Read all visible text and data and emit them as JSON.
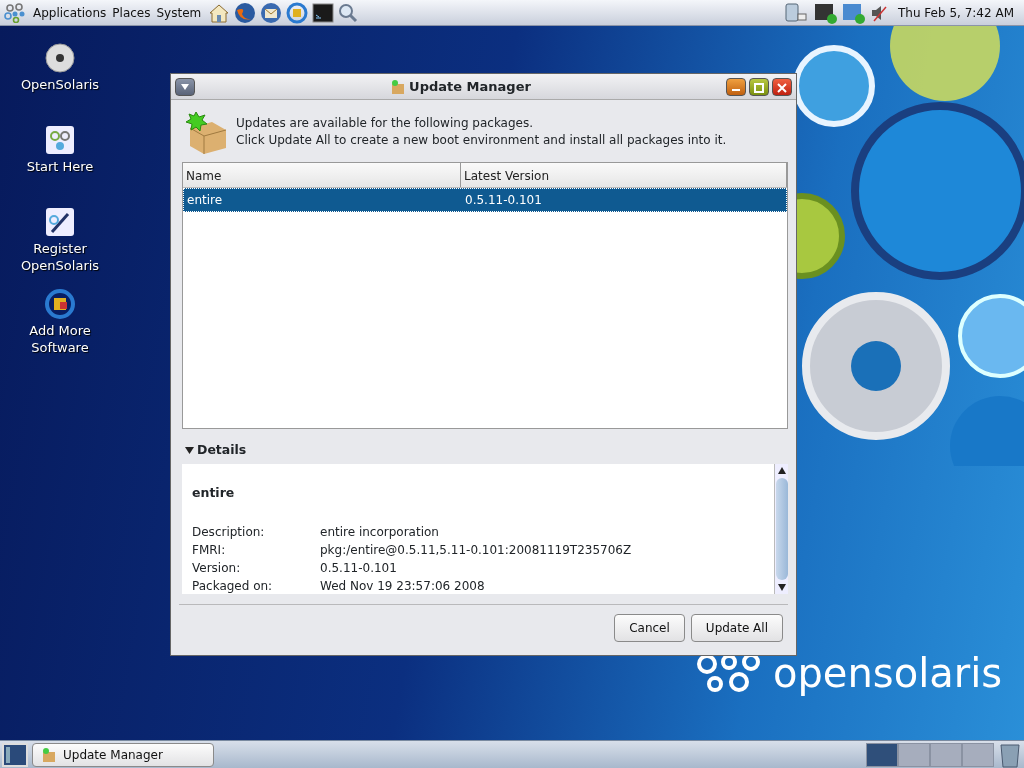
{
  "top_panel": {
    "menus": [
      "Applications",
      "Places",
      "System"
    ],
    "clock": "Thu Feb  5,  7:42 AM"
  },
  "desktop_icons": [
    {
      "label": "OpenSolaris",
      "kind": "disc"
    },
    {
      "label": "Start Here",
      "kind": "start"
    },
    {
      "label": "Register OpenSolaris",
      "kind": "register"
    },
    {
      "label": "Add More Software",
      "kind": "software"
    }
  ],
  "wallpaper": {
    "logo_text": "opensolaris"
  },
  "window": {
    "title": "Update Manager",
    "message": [
      "Updates are available for the following packages.",
      "Click Update All to create a new boot environment and install all packages into it."
    ],
    "table": {
      "columns": [
        "Name",
        "Latest Version"
      ],
      "rows": [
        {
          "cells": [
            "entire",
            "0.5.11-0.101"
          ],
          "selected": true
        }
      ]
    },
    "details": {
      "label": "Details",
      "expanded": true,
      "heading": "entire",
      "fields": [
        {
          "label": "Description:",
          "value": "entire incorporation"
        },
        {
          "label": "FMRI:",
          "value": "pkg:/entire@0.5.11,5.11-0.101:20081119T235706Z"
        },
        {
          "label": "Version:",
          "value": "0.5.11-0.101"
        },
        {
          "label": "Packaged on:",
          "value": "Wed Nov 19 23:57:06 2008"
        }
      ]
    },
    "buttons": [
      "Cancel",
      "Update All"
    ]
  },
  "bottom_panel": {
    "tasks": [
      {
        "label": "Update Manager"
      }
    ],
    "workspaces": [
      {
        "selected": true
      },
      {
        "selected": false
      },
      {
        "selected": false
      },
      {
        "selected": false
      }
    ]
  }
}
